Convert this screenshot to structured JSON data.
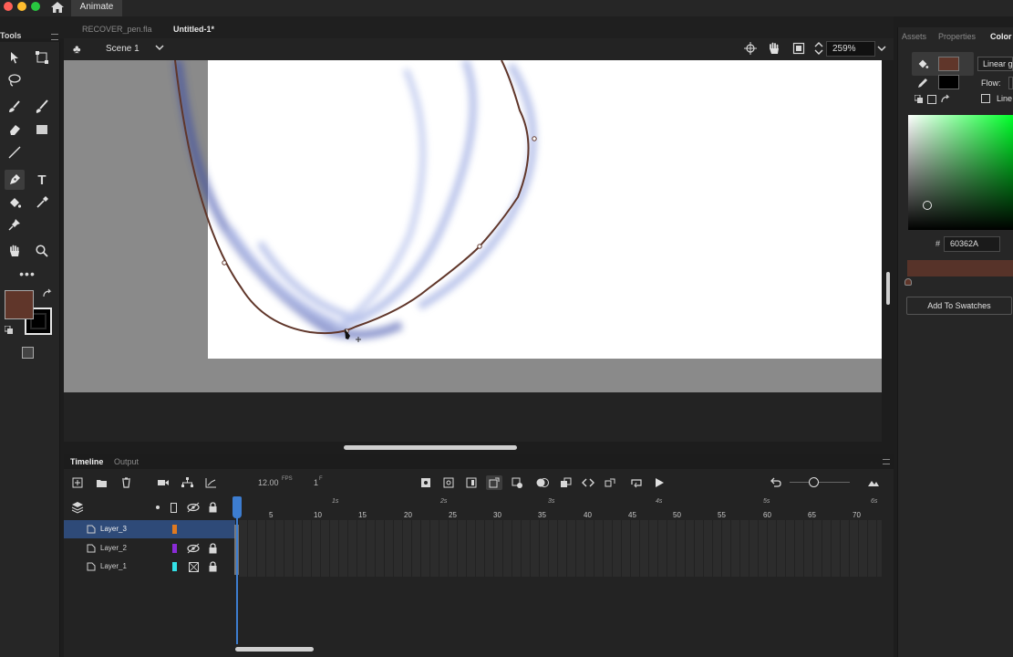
{
  "app": {
    "name": "Animate"
  },
  "tabs": [
    {
      "label": "RECOVER_pen.fla",
      "active": false
    },
    {
      "label": "Untitled-1*",
      "active": true
    }
  ],
  "tools_panel": {
    "title": "Tools"
  },
  "stage_header": {
    "scene": "Scene 1",
    "zoom": "259%"
  },
  "right_panel": {
    "tabs": [
      "Assets",
      "Properties",
      "Color"
    ],
    "fill_type": "Linear g",
    "flow_label": "Flow:",
    "line_label": "Line",
    "hash": "#",
    "hex": "60362A",
    "add_swatches": "Add To Swatches"
  },
  "colors": {
    "fill": "#60362A",
    "stroke": "#000000",
    "accent": "#3d7dd0"
  },
  "timeline": {
    "tabs": [
      "Timeline",
      "Output"
    ],
    "fps": "12.00",
    "fps_unit": "FPS",
    "frame": "1",
    "frame_unit": "F",
    "ruler": [
      "5",
      "10",
      "15",
      "20",
      "25",
      "30",
      "35",
      "40",
      "45",
      "50",
      "55",
      "60",
      "65",
      "70"
    ],
    "seconds": [
      "1s",
      "2s",
      "3s",
      "4s",
      "5s",
      "6s"
    ],
    "layers": [
      {
        "name": "Layer_3",
        "color": "#e07a20",
        "selected": true
      },
      {
        "name": "Layer_2",
        "color": "#8a2bd6",
        "selected": false
      },
      {
        "name": "Layer_1",
        "color": "#33e0e6",
        "selected": false
      }
    ]
  }
}
